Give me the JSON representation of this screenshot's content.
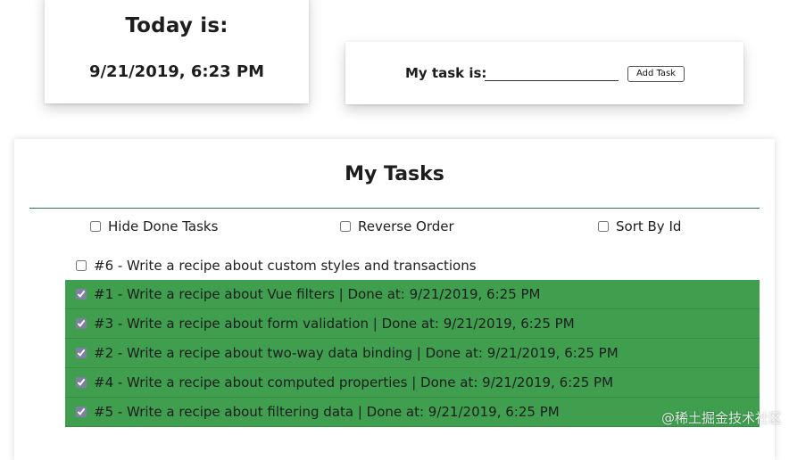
{
  "today": {
    "title": "Today is:",
    "datetime": "9/21/2019, 6:23 PM"
  },
  "task_entry": {
    "label": "My task is:",
    "input_value": "",
    "add_button_label": "Add Task"
  },
  "tasks_panel": {
    "title": "My Tasks",
    "options": {
      "hide_done": {
        "label": "Hide Done Tasks",
        "checked": false
      },
      "reverse_order": {
        "label": "Reverse Order",
        "checked": false
      },
      "sort_by_id": {
        "label": "Sort By Id",
        "checked": false
      }
    },
    "items": [
      {
        "text": "#6 - Write a recipe about custom styles and transactions",
        "done": false
      },
      {
        "text": "#1 - Write a recipe about Vue filters | Done at: 9/21/2019, 6:25 PM",
        "done": true
      },
      {
        "text": "#3 - Write a recipe about form validation | Done at: 9/21/2019, 6:25 PM",
        "done": true
      },
      {
        "text": "#2 - Write a recipe about two-way data binding | Done at: 9/21/2019, 6:25 PM",
        "done": true
      },
      {
        "text": "#4 - Write a recipe about computed properties | Done at: 9/21/2019, 6:25 PM",
        "done": true
      },
      {
        "text": "#5 - Write a recipe about filtering data | Done at: 9/21/2019, 6:25 PM",
        "done": true
      }
    ]
  },
  "colors": {
    "done_row_bg": "#3f9f4f",
    "divider": "#2d6f4f"
  },
  "watermark": "@稀土掘金技术社区"
}
